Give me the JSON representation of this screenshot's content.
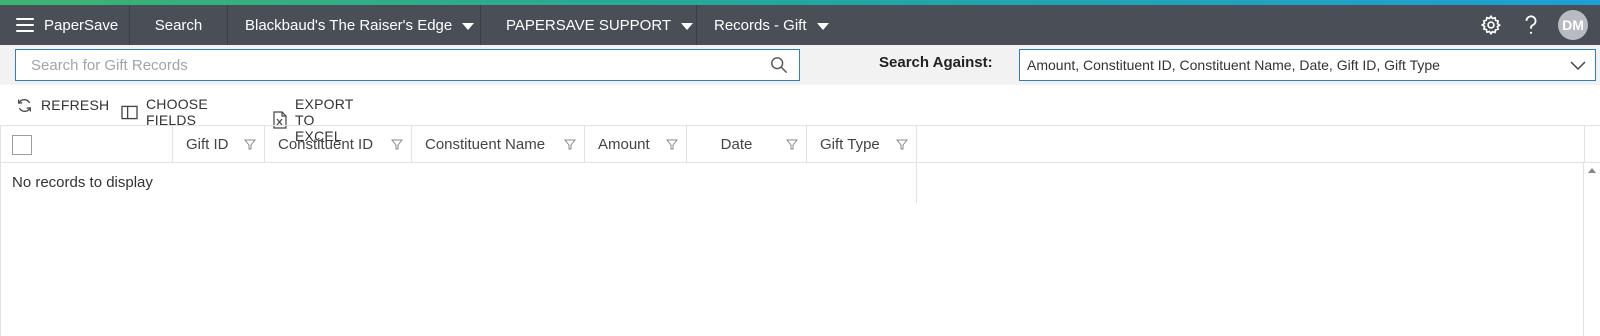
{
  "app": {
    "brand": "PaperSave",
    "search": "Search",
    "product": "Blackbaud's The Raiser's Edge",
    "support": "PAPERSAVE SUPPORT",
    "records": "Records - Gift",
    "avatar_initials": "DM",
    "icons": [
      "hamburger-icon",
      "gear-icon",
      "help-icon"
    ],
    "colors": {
      "topbar": "#4a4f57",
      "accent_start": "#3cb371",
      "accent_end": "#1e9fd6",
      "focus_border": "#2d7fc1"
    }
  },
  "searchbar": {
    "placeholder": "Search for Gift Records",
    "value": "",
    "against_label": "Search Against:",
    "against_value": "Amount, Constituent ID, Constituent Name, Date, Gift ID, Gift Type"
  },
  "toolbar": {
    "refresh": "REFRESH",
    "choose_fields": "CHOOSE FIELDS",
    "export": "EXPORT TO EXCEL"
  },
  "grid": {
    "columns": [
      "Gift ID",
      "Constituent ID",
      "Constituent Name",
      "Amount",
      "Date",
      "Gift Type"
    ],
    "rows": [],
    "empty_message": "No records to display"
  }
}
